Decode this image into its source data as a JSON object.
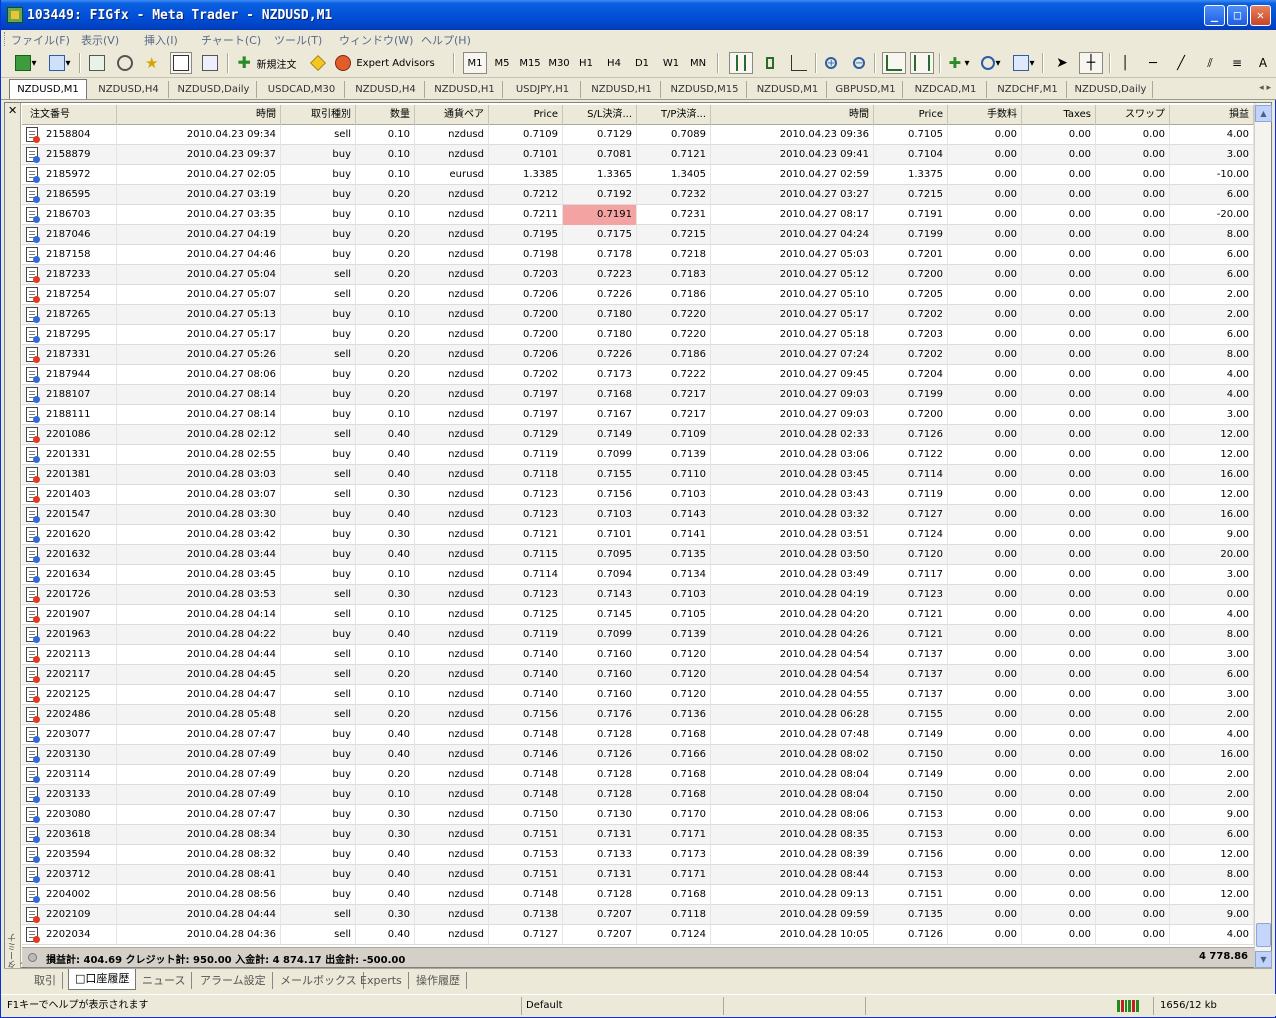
{
  "window": {
    "title": "103449: FIGfx - Meta Trader - NZDUSD,M1"
  },
  "menu": [
    "ファイル(F)",
    "表示(V)",
    "挿入(I)",
    "チャート(C)",
    "ツール(T)",
    "ウィンドウ(W)",
    "ヘルプ(H)"
  ],
  "toolbar": {
    "new_order": "新規注文",
    "expert_advisors": "Expert Advisors",
    "timeframes": [
      "M1",
      "M5",
      "M15",
      "M30",
      "H1",
      "H4",
      "D1",
      "W1",
      "MN"
    ],
    "active_timeframe": "M1"
  },
  "chart_tabs": [
    "NZDUSD,M1",
    "NZDUSD,H4",
    "NZDUSD,Daily",
    "USDCAD,M30",
    "NZDUSD,H4",
    "NZDUSD,H1",
    "USDJPY,H1",
    "NZDUSD,H1",
    "NZDUSD,M15",
    "NZDUSD,M1",
    "GBPUSD,M1",
    "NZDCAD,M1",
    "NZDCHF,M1",
    "NZDUSD,Daily"
  ],
  "terminal": {
    "side_label": "ターミナル",
    "columns": [
      "注文番号",
      "時間",
      "取引種別",
      "数量",
      "通貨ペア",
      "Price",
      "S/L決済...",
      "T/P決済...",
      "時間",
      "Price",
      "手数料",
      "Taxes",
      "スワップ",
      "損益"
    ],
    "rows": [
      [
        "2158804",
        "2010.04.23 09:34",
        "sell",
        "0.10",
        "nzdusd",
        "0.7109",
        "0.7129",
        "0.7089",
        "2010.04.23 09:36",
        "0.7105",
        "0.00",
        "0.00",
        "0.00",
        "4.00"
      ],
      [
        "2158879",
        "2010.04.23 09:37",
        "buy",
        "0.10",
        "nzdusd",
        "0.7101",
        "0.7081",
        "0.7121",
        "2010.04.23 09:41",
        "0.7104",
        "0.00",
        "0.00",
        "0.00",
        "3.00"
      ],
      [
        "2185972",
        "2010.04.27 02:05",
        "buy",
        "0.10",
        "eurusd",
        "1.3385",
        "1.3365",
        "1.3405",
        "2010.04.27 02:59",
        "1.3375",
        "0.00",
        "0.00",
        "0.00",
        "-10.00"
      ],
      [
        "2186595",
        "2010.04.27 03:19",
        "buy",
        "0.20",
        "nzdusd",
        "0.7212",
        "0.7192",
        "0.7232",
        "2010.04.27 03:27",
        "0.7215",
        "0.00",
        "0.00",
        "0.00",
        "6.00"
      ],
      [
        "2186703",
        "2010.04.27 03:35",
        "buy",
        "0.10",
        "nzdusd",
        "0.7211",
        "0.7191",
        "0.7231",
        "2010.04.27 08:17",
        "0.7191",
        "0.00",
        "0.00",
        "0.00",
        "-20.00"
      ],
      [
        "2187046",
        "2010.04.27 04:19",
        "buy",
        "0.20",
        "nzdusd",
        "0.7195",
        "0.7175",
        "0.7215",
        "2010.04.27 04:24",
        "0.7199",
        "0.00",
        "0.00",
        "0.00",
        "8.00"
      ],
      [
        "2187158",
        "2010.04.27 04:46",
        "buy",
        "0.20",
        "nzdusd",
        "0.7198",
        "0.7178",
        "0.7218",
        "2010.04.27 05:03",
        "0.7201",
        "0.00",
        "0.00",
        "0.00",
        "6.00"
      ],
      [
        "2187233",
        "2010.04.27 05:04",
        "sell",
        "0.20",
        "nzdusd",
        "0.7203",
        "0.7223",
        "0.7183",
        "2010.04.27 05:12",
        "0.7200",
        "0.00",
        "0.00",
        "0.00",
        "6.00"
      ],
      [
        "2187254",
        "2010.04.27 05:07",
        "sell",
        "0.20",
        "nzdusd",
        "0.7206",
        "0.7226",
        "0.7186",
        "2010.04.27 05:10",
        "0.7205",
        "0.00",
        "0.00",
        "0.00",
        "2.00"
      ],
      [
        "2187265",
        "2010.04.27 05:13",
        "buy",
        "0.10",
        "nzdusd",
        "0.7200",
        "0.7180",
        "0.7220",
        "2010.04.27 05:17",
        "0.7202",
        "0.00",
        "0.00",
        "0.00",
        "2.00"
      ],
      [
        "2187295",
        "2010.04.27 05:17",
        "buy",
        "0.20",
        "nzdusd",
        "0.7200",
        "0.7180",
        "0.7220",
        "2010.04.27 05:18",
        "0.7203",
        "0.00",
        "0.00",
        "0.00",
        "6.00"
      ],
      [
        "2187331",
        "2010.04.27 05:26",
        "sell",
        "0.20",
        "nzdusd",
        "0.7206",
        "0.7226",
        "0.7186",
        "2010.04.27 07:24",
        "0.7202",
        "0.00",
        "0.00",
        "0.00",
        "8.00"
      ],
      [
        "2187944",
        "2010.04.27 08:06",
        "buy",
        "0.20",
        "nzdusd",
        "0.7202",
        "0.7173",
        "0.7222",
        "2010.04.27 09:45",
        "0.7204",
        "0.00",
        "0.00",
        "0.00",
        "4.00"
      ],
      [
        "2188107",
        "2010.04.27 08:14",
        "buy",
        "0.20",
        "nzdusd",
        "0.7197",
        "0.7168",
        "0.7217",
        "2010.04.27 09:03",
        "0.7199",
        "0.00",
        "0.00",
        "0.00",
        "4.00"
      ],
      [
        "2188111",
        "2010.04.27 08:14",
        "buy",
        "0.10",
        "nzdusd",
        "0.7197",
        "0.7167",
        "0.7217",
        "2010.04.27 09:03",
        "0.7200",
        "0.00",
        "0.00",
        "0.00",
        "3.00"
      ],
      [
        "2201086",
        "2010.04.28 02:12",
        "sell",
        "0.40",
        "nzdusd",
        "0.7129",
        "0.7149",
        "0.7109",
        "2010.04.28 02:33",
        "0.7126",
        "0.00",
        "0.00",
        "0.00",
        "12.00"
      ],
      [
        "2201331",
        "2010.04.28 02:55",
        "buy",
        "0.40",
        "nzdusd",
        "0.7119",
        "0.7099",
        "0.7139",
        "2010.04.28 03:06",
        "0.7122",
        "0.00",
        "0.00",
        "0.00",
        "12.00"
      ],
      [
        "2201381",
        "2010.04.28 03:03",
        "sell",
        "0.40",
        "nzdusd",
        "0.7118",
        "0.7155",
        "0.7110",
        "2010.04.28 03:45",
        "0.7114",
        "0.00",
        "0.00",
        "0.00",
        "16.00"
      ],
      [
        "2201403",
        "2010.04.28 03:07",
        "sell",
        "0.30",
        "nzdusd",
        "0.7123",
        "0.7156",
        "0.7103",
        "2010.04.28 03:43",
        "0.7119",
        "0.00",
        "0.00",
        "0.00",
        "12.00"
      ],
      [
        "2201547",
        "2010.04.28 03:30",
        "buy",
        "0.40",
        "nzdusd",
        "0.7123",
        "0.7103",
        "0.7143",
        "2010.04.28 03:32",
        "0.7127",
        "0.00",
        "0.00",
        "0.00",
        "16.00"
      ],
      [
        "2201620",
        "2010.04.28 03:42",
        "buy",
        "0.30",
        "nzdusd",
        "0.7121",
        "0.7101",
        "0.7141",
        "2010.04.28 03:51",
        "0.7124",
        "0.00",
        "0.00",
        "0.00",
        "9.00"
      ],
      [
        "2201632",
        "2010.04.28 03:44",
        "buy",
        "0.40",
        "nzdusd",
        "0.7115",
        "0.7095",
        "0.7135",
        "2010.04.28 03:50",
        "0.7120",
        "0.00",
        "0.00",
        "0.00",
        "20.00"
      ],
      [
        "2201634",
        "2010.04.28 03:45",
        "buy",
        "0.10",
        "nzdusd",
        "0.7114",
        "0.7094",
        "0.7134",
        "2010.04.28 03:49",
        "0.7117",
        "0.00",
        "0.00",
        "0.00",
        "3.00"
      ],
      [
        "2201726",
        "2010.04.28 03:53",
        "sell",
        "0.30",
        "nzdusd",
        "0.7123",
        "0.7143",
        "0.7103",
        "2010.04.28 04:19",
        "0.7123",
        "0.00",
        "0.00",
        "0.00",
        "0.00"
      ],
      [
        "2201907",
        "2010.04.28 04:14",
        "sell",
        "0.10",
        "nzdusd",
        "0.7125",
        "0.7145",
        "0.7105",
        "2010.04.28 04:20",
        "0.7121",
        "0.00",
        "0.00",
        "0.00",
        "4.00"
      ],
      [
        "2201963",
        "2010.04.28 04:22",
        "buy",
        "0.40",
        "nzdusd",
        "0.7119",
        "0.7099",
        "0.7139",
        "2010.04.28 04:26",
        "0.7121",
        "0.00",
        "0.00",
        "0.00",
        "8.00"
      ],
      [
        "2202113",
        "2010.04.28 04:44",
        "sell",
        "0.10",
        "nzdusd",
        "0.7140",
        "0.7160",
        "0.7120",
        "2010.04.28 04:54",
        "0.7137",
        "0.00",
        "0.00",
        "0.00",
        "3.00"
      ],
      [
        "2202117",
        "2010.04.28 04:45",
        "sell",
        "0.20",
        "nzdusd",
        "0.7140",
        "0.7160",
        "0.7120",
        "2010.04.28 04:54",
        "0.7137",
        "0.00",
        "0.00",
        "0.00",
        "6.00"
      ],
      [
        "2202125",
        "2010.04.28 04:47",
        "sell",
        "0.10",
        "nzdusd",
        "0.7140",
        "0.7160",
        "0.7120",
        "2010.04.28 04:55",
        "0.7137",
        "0.00",
        "0.00",
        "0.00",
        "3.00"
      ],
      [
        "2202486",
        "2010.04.28 05:48",
        "sell",
        "0.20",
        "nzdusd",
        "0.7156",
        "0.7176",
        "0.7136",
        "2010.04.28 06:28",
        "0.7155",
        "0.00",
        "0.00",
        "0.00",
        "2.00"
      ],
      [
        "2203077",
        "2010.04.28 07:47",
        "buy",
        "0.40",
        "nzdusd",
        "0.7148",
        "0.7128",
        "0.7168",
        "2010.04.28 07:48",
        "0.7149",
        "0.00",
        "0.00",
        "0.00",
        "4.00"
      ],
      [
        "2203130",
        "2010.04.28 07:49",
        "buy",
        "0.40",
        "nzdusd",
        "0.7146",
        "0.7126",
        "0.7166",
        "2010.04.28 08:02",
        "0.7150",
        "0.00",
        "0.00",
        "0.00",
        "16.00"
      ],
      [
        "2203114",
        "2010.04.28 07:49",
        "buy",
        "0.20",
        "nzdusd",
        "0.7148",
        "0.7128",
        "0.7168",
        "2010.04.28 08:04",
        "0.7149",
        "0.00",
        "0.00",
        "0.00",
        "2.00"
      ],
      [
        "2203133",
        "2010.04.28 07:49",
        "buy",
        "0.10",
        "nzdusd",
        "0.7148",
        "0.7128",
        "0.7168",
        "2010.04.28 08:04",
        "0.7150",
        "0.00",
        "0.00",
        "0.00",
        "2.00"
      ],
      [
        "2203080",
        "2010.04.28 07:47",
        "buy",
        "0.30",
        "nzdusd",
        "0.7150",
        "0.7130",
        "0.7170",
        "2010.04.28 08:06",
        "0.7153",
        "0.00",
        "0.00",
        "0.00",
        "9.00"
      ],
      [
        "2203618",
        "2010.04.28 08:34",
        "buy",
        "0.30",
        "nzdusd",
        "0.7151",
        "0.7131",
        "0.7171",
        "2010.04.28 08:35",
        "0.7153",
        "0.00",
        "0.00",
        "0.00",
        "6.00"
      ],
      [
        "2203594",
        "2010.04.28 08:32",
        "buy",
        "0.40",
        "nzdusd",
        "0.7153",
        "0.7133",
        "0.7173",
        "2010.04.28 08:39",
        "0.7156",
        "0.00",
        "0.00",
        "0.00",
        "12.00"
      ],
      [
        "2203712",
        "2010.04.28 08:41",
        "buy",
        "0.40",
        "nzdusd",
        "0.7151",
        "0.7131",
        "0.7171",
        "2010.04.28 08:44",
        "0.7153",
        "0.00",
        "0.00",
        "0.00",
        "8.00"
      ],
      [
        "2204002",
        "2010.04.28 08:56",
        "buy",
        "0.40",
        "nzdusd",
        "0.7148",
        "0.7128",
        "0.7168",
        "2010.04.28 09:13",
        "0.7151",
        "0.00",
        "0.00",
        "0.00",
        "12.00"
      ],
      [
        "2202109",
        "2010.04.28 04:44",
        "sell",
        "0.30",
        "nzdusd",
        "0.7138",
        "0.7207",
        "0.7118",
        "2010.04.28 09:59",
        "0.7135",
        "0.00",
        "0.00",
        "0.00",
        "9.00"
      ],
      [
        "2202034",
        "2010.04.28 04:36",
        "sell",
        "0.40",
        "nzdusd",
        "0.7127",
        "0.7207",
        "0.7124",
        "2010.04.28 10:05",
        "0.7126",
        "0.00",
        "0.00",
        "0.00",
        "4.00"
      ]
    ],
    "summary": "損益計: 404.69  クレジット計: 950.00  入金計: 4 874.17  出金計: -500.00",
    "summary_total": "4 778.86"
  },
  "bottom_tabs": [
    "取引",
    "口座履歴",
    "ニュース",
    "アラーム設定",
    "メールボックス",
    "Experts",
    "操作履歴"
  ],
  "active_bottom_tab": "口座履歴",
  "status": {
    "help": "F1キーでヘルプが表示されます",
    "profile": "Default",
    "traffic": "1656/12 kb"
  }
}
